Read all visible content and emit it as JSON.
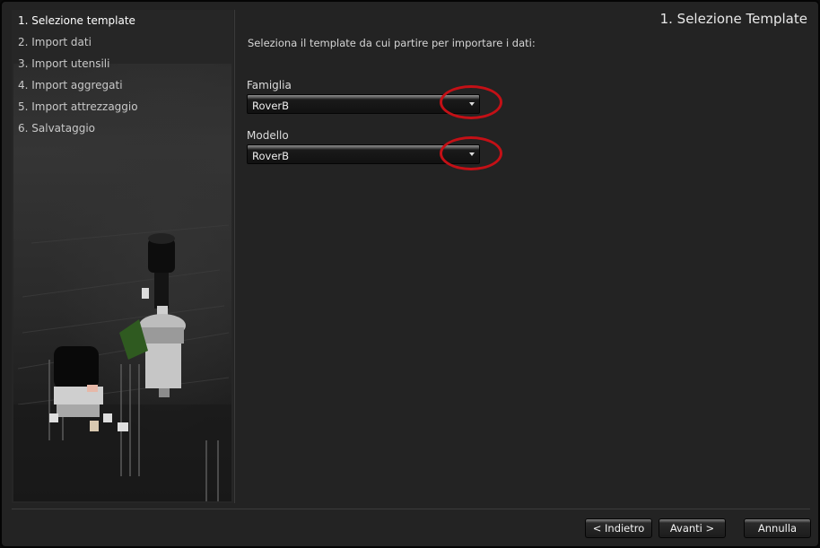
{
  "wizard": {
    "steps": [
      {
        "label": "1. Selezione template",
        "active": true
      },
      {
        "label": "2. Import dati",
        "active": false
      },
      {
        "label": "3. Import utensili",
        "active": false
      },
      {
        "label": "4. Import aggregati",
        "active": false
      },
      {
        "label": "5. Import attrezzaggio",
        "active": false
      },
      {
        "label": "6. Salvataggio",
        "active": false
      }
    ]
  },
  "main": {
    "title": "1. Selezione Template",
    "instruction": "Seleziona il template da cui partire per importare i dati:",
    "family_label": "Famiglia",
    "family_value": "RoverB",
    "model_label": "Modello",
    "model_value": "RoverB"
  },
  "footer": {
    "back_label": "< Indietro",
    "next_label": "Avanti >",
    "cancel_label": "Annulla"
  },
  "colors": {
    "background": "#232323",
    "highlight": "#c41016"
  }
}
